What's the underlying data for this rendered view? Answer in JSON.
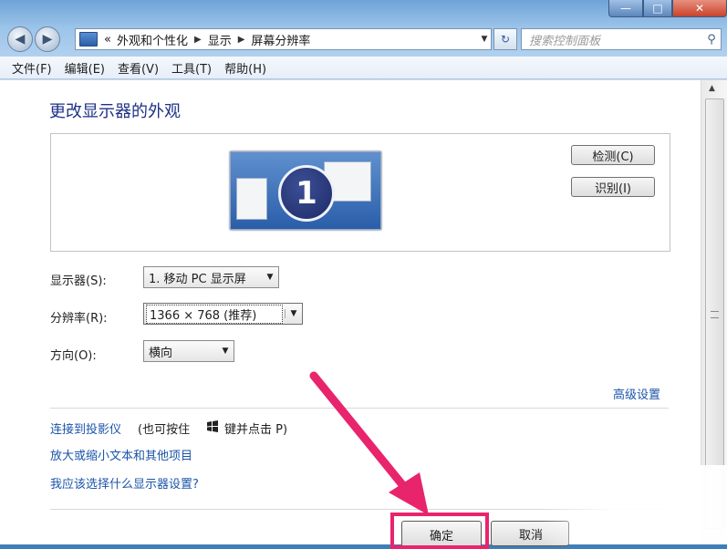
{
  "window": {
    "minimize_label": "—",
    "maximize_label": "□",
    "close_label": "✕"
  },
  "address_bar": {
    "overflow": "«",
    "crumbs": [
      "外观和个性化",
      "显示",
      "屏幕分辨率"
    ]
  },
  "search": {
    "placeholder": "搜索控制面板"
  },
  "menu": [
    "文件(F)",
    "编辑(E)",
    "查看(V)",
    "工具(T)",
    "帮助(H)"
  ],
  "page": {
    "title": "更改显示器的外观",
    "monitor_number": "1",
    "detect_button": "检测(C)",
    "identify_button": "识别(I)"
  },
  "fields": {
    "display_label": "显示器(S):",
    "display_value": "1. 移动 PC 显示屏",
    "resolution_label": "分辨率(R):",
    "resolution_value": "1366 × 768 (推荐)",
    "orientation_label": "方向(O):",
    "orientation_value": "横向"
  },
  "links": {
    "advanced": "高级设置",
    "projector": "连接到投影仪",
    "projector_hint_prefix": "(也可按住",
    "projector_hint_suffix": "键并点击 P)",
    "text_size": "放大或缩小文本和其他项目",
    "which_settings": "我应该选择什么显示器设置?"
  },
  "footer": {
    "ok_label": "确定",
    "cancel_label": "取消"
  },
  "colors": {
    "highlight": "#e8246d",
    "link": "#1b54a8",
    "title": "#1e3287"
  }
}
